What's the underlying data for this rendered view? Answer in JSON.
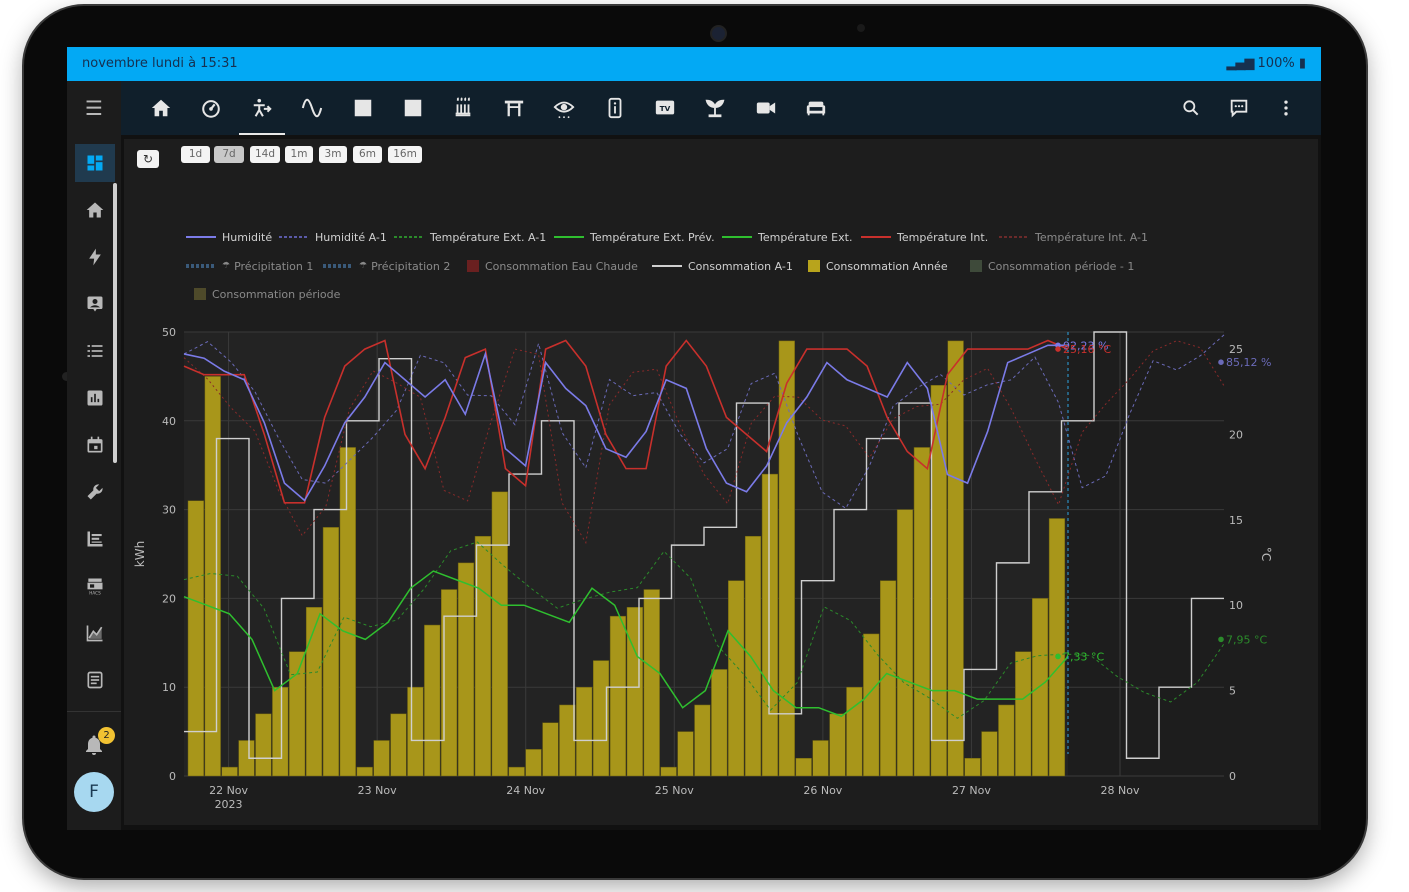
{
  "status_bar": {
    "left": "novembre lundi à 15:31",
    "right": "100%"
  },
  "sidebar": {
    "items": [
      {
        "name": "sidebar-item-overview",
        "icon": "dashboard-icon",
        "active": true
      },
      {
        "name": "sidebar-item-home",
        "icon": "home-icon"
      },
      {
        "name": "sidebar-item-energy",
        "icon": "lightning-icon"
      },
      {
        "name": "sidebar-item-person",
        "icon": "person-card-icon"
      },
      {
        "name": "sidebar-item-list",
        "icon": "list-icon"
      },
      {
        "name": "sidebar-item-stats",
        "icon": "bar-chart-icon"
      },
      {
        "name": "sidebar-item-calendar",
        "icon": "calendar-icon"
      },
      {
        "name": "sidebar-item-tools",
        "icon": "wrench-icon"
      },
      {
        "name": "sidebar-item-history",
        "icon": "chart-box-icon"
      },
      {
        "name": "sidebar-item-hacs",
        "icon": "hacs-store-icon"
      },
      {
        "name": "sidebar-item-graphs",
        "icon": "line-chart-icon"
      },
      {
        "name": "sidebar-item-logbook",
        "icon": "notes-icon"
      }
    ],
    "notifications_count": "2",
    "avatar_initial": "F"
  },
  "top_tabs": [
    {
      "icon": "home-icon"
    },
    {
      "icon": "gauge-icon"
    },
    {
      "icon": "weather-run-icon",
      "active": true
    },
    {
      "icon": "sine-wave-icon"
    },
    {
      "icon": "square-icon"
    },
    {
      "icon": "square-icon"
    },
    {
      "icon": "heater-icon"
    },
    {
      "icon": "gate-icon"
    },
    {
      "icon": "eye-icon"
    },
    {
      "icon": "info-box-icon"
    },
    {
      "icon": "tv-icon"
    },
    {
      "icon": "plant-icon"
    },
    {
      "icon": "camera-icon"
    },
    {
      "icon": "sofa-icon"
    }
  ],
  "toolbar": {
    "search": "search-icon",
    "assist": "chat-icon",
    "more": "dots-vertical-icon"
  },
  "refresh_label": "↻",
  "range_buttons": [
    "1d",
    "7d",
    "14d",
    "1m",
    "3m",
    "6m",
    "16m"
  ],
  "selected_range": "7d",
  "colors": {
    "humidity": "#7b7be8",
    "temp_int": "#c8302c",
    "temp_ext": "#2fbf2f",
    "conso": "#a8961a",
    "conso_a1": "#cfcfcf",
    "statusbar": "#03a9f4",
    "active_item": "#203a4e"
  },
  "chart_data": {
    "type": "line",
    "x": [
      "22 Nov 2023",
      "23 Nov",
      "24 Nov",
      "25 Nov",
      "26 Nov",
      "27 Nov",
      "28 Nov"
    ],
    "x_ticks": [
      "22 Nov",
      "23 Nov",
      "24 Nov",
      "25 Nov",
      "26 Nov",
      "27 Nov",
      "28 Nov"
    ],
    "x_year": "2023",
    "ylabel": "kWh",
    "y2label": "°C",
    "ylim": [
      0,
      50
    ],
    "y2lim": [
      0,
      26
    ],
    "y_ticks": [
      0,
      10,
      20,
      30,
      40,
      50
    ],
    "y2_ticks": [
      0,
      5,
      10,
      15,
      20,
      25
    ],
    "legend": [
      "Humidité",
      "Humidité A-1",
      "Température Ext. A-1",
      "Température Ext. Prév.",
      "Température Ext.",
      "Température Int.",
      "Température Int. A-1",
      "Précipitation 1",
      "Précipitation 2",
      "Consommation Eau Chaude",
      "Consommation A-1",
      "Consommation Année",
      "Consommation période - 1",
      "Consommation période"
    ],
    "series": [
      {
        "name": "Humidité",
        "values": [
          49,
          48.5,
          47,
          46,
          41,
          34,
          32,
          36,
          41,
          44,
          48,
          46,
          44,
          46,
          42,
          49,
          38,
          36,
          48,
          45,
          43,
          38,
          37,
          40,
          46,
          45,
          38,
          34,
          33,
          36,
          41,
          44,
          48,
          46,
          45,
          44,
          48,
          45,
          35,
          34,
          40,
          48,
          49,
          50,
          50
        ]
      },
      {
        "name": "Température Int.",
        "values": [
          24,
          23.5,
          23.5,
          23.5,
          20,
          16,
          16,
          21,
          24,
          25,
          25.5,
          20,
          18,
          21,
          24.5,
          25,
          18,
          17,
          25,
          25.5,
          24,
          20,
          18,
          18,
          24,
          25.5,
          24,
          21,
          20,
          19,
          23,
          25,
          25,
          25,
          24,
          21,
          19,
          18,
          23.5,
          25,
          25,
          25,
          25,
          25.5,
          25
        ]
      },
      {
        "name": "Température Ext.",
        "values": [
          10.5,
          10,
          9.5,
          8,
          5,
          6,
          9.5,
          8.5,
          8,
          9,
          11,
          12,
          11.5,
          11,
          10,
          10,
          9.5,
          9,
          11,
          10,
          7,
          6,
          4,
          5,
          8.5,
          7,
          5,
          4,
          4,
          3.5,
          4.5,
          6,
          5.5,
          5,
          5,
          4.5,
          4.5,
          4.5,
          5.5,
          7
        ]
      },
      {
        "name": "Consommation Année",
        "values": [
          31,
          45,
          1,
          4,
          7,
          10,
          14,
          19,
          28,
          37,
          1,
          4,
          7,
          10,
          17,
          21,
          24,
          27,
          32,
          1,
          3,
          6,
          8,
          10,
          13,
          18,
          19,
          21,
          1,
          5,
          8,
          12,
          22,
          27,
          34,
          49,
          2,
          4,
          7,
          10,
          16,
          22,
          30,
          37,
          44,
          49,
          2,
          5,
          8,
          14,
          20,
          29
        ]
      },
      {
        "name": "Consommation A-1",
        "values": [
          5,
          38,
          2,
          20,
          30,
          40,
          47,
          4,
          18,
          26,
          34,
          40,
          4,
          10,
          20,
          26,
          28,
          42,
          7,
          22,
          30,
          38,
          42,
          4,
          12,
          24,
          32,
          40,
          50,
          2,
          10,
          20
        ]
      }
    ],
    "annotations": [
      {
        "series": "Humidité",
        "value": "92,23 %"
      },
      {
        "series": "Température Int.",
        "value": "25,16 °C"
      },
      {
        "series": "Température Ext.",
        "value": "7,33 °C"
      },
      {
        "series": "Humidité A-1",
        "value": "85,12 %"
      },
      {
        "series": "Température Ext. A-1",
        "value": "7,95 °C"
      }
    ]
  }
}
